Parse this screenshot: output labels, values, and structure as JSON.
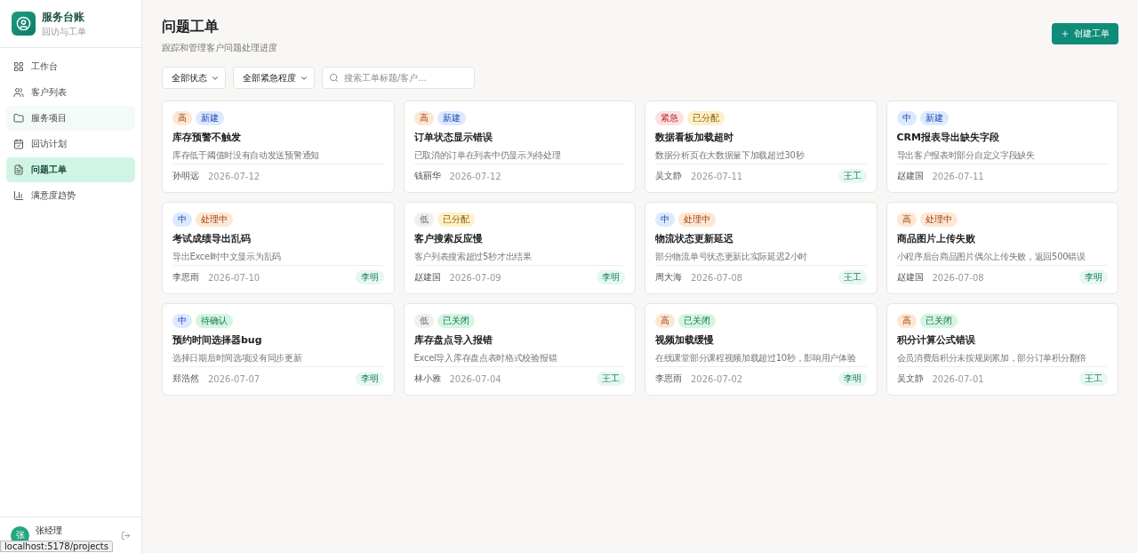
{
  "brand": {
    "title": "服务台账",
    "subtitle": "回访与工单"
  },
  "nav": [
    {
      "label": "工作台",
      "selected": false,
      "hovered": false
    },
    {
      "label": "客户列表",
      "selected": false,
      "hovered": false
    },
    {
      "label": "服务项目",
      "selected": false,
      "hovered": true
    },
    {
      "label": "回访计划",
      "selected": false,
      "hovered": false
    },
    {
      "label": "问题工单",
      "selected": true,
      "hovered": false
    },
    {
      "label": "满意度趋势",
      "selected": false,
      "hovered": false
    }
  ],
  "user": {
    "avatar": "张",
    "name": "张经理"
  },
  "status_tooltip": "localhost:5178/projects",
  "page": {
    "title": "问题工单",
    "subtitle": "跟踪和管理客户问题处理进度",
    "create_button": "创建工单"
  },
  "filters": {
    "status": "全部状态",
    "priority": "全部紧急程度",
    "search_placeholder": "搜索工单标题/客户..."
  },
  "tickets": [
    {
      "priority": {
        "label": "高",
        "kind": "high"
      },
      "status": {
        "label": "新建",
        "kind": "new"
      },
      "title": "库存预警不触发",
      "description": "库存低于阈值时没有自动发送预警通知",
      "customer": "孙明远",
      "date": "2026-07-12"
    },
    {
      "priority": {
        "label": "高",
        "kind": "high"
      },
      "status": {
        "label": "新建",
        "kind": "new"
      },
      "title": "订单状态显示错误",
      "description": "已取消的订单在列表中仍显示为待处理",
      "customer": "钱丽华",
      "date": "2026-07-12"
    },
    {
      "priority": {
        "label": "紧急",
        "kind": "urgent"
      },
      "status": {
        "label": "已分配",
        "kind": "assigned"
      },
      "title": "数据看板加载超时",
      "description": "数据分析页在大数据量下加载超过30秒",
      "customer": "吴文静",
      "date": "2026-07-11",
      "assignee": "王工"
    },
    {
      "priority": {
        "label": "中",
        "kind": "medium"
      },
      "status": {
        "label": "新建",
        "kind": "new"
      },
      "title": "CRM报表导出缺失字段",
      "description": "导出客户报表时部分自定义字段缺失",
      "customer": "赵建国",
      "date": "2026-07-11"
    },
    {
      "priority": {
        "label": "中",
        "kind": "medium"
      },
      "status": {
        "label": "处理中",
        "kind": "processing"
      },
      "title": "考试成绩导出乱码",
      "description": "导出Excel时中文显示为乱码",
      "customer": "李思雨",
      "date": "2026-07-10",
      "assignee": "李明"
    },
    {
      "priority": {
        "label": "低",
        "kind": "low"
      },
      "status": {
        "label": "已分配",
        "kind": "assigned"
      },
      "title": "客户搜索反应慢",
      "description": "客户列表搜索超过5秒才出结果",
      "customer": "赵建国",
      "date": "2026-07-09",
      "assignee": "李明"
    },
    {
      "priority": {
        "label": "中",
        "kind": "medium"
      },
      "status": {
        "label": "处理中",
        "kind": "processing"
      },
      "title": "物流状态更新延迟",
      "description": "部分物流单号状态更新比实际延迟2小时",
      "customer": "周大海",
      "date": "2026-07-08",
      "assignee": "王工"
    },
    {
      "priority": {
        "label": "高",
        "kind": "high"
      },
      "status": {
        "label": "处理中",
        "kind": "processing"
      },
      "title": "商品图片上传失败",
      "description": "小程序后台商品图片偶尔上传失败，返回500错误",
      "customer": "赵建国",
      "date": "2026-07-08",
      "assignee": "李明"
    },
    {
      "priority": {
        "label": "中",
        "kind": "medium"
      },
      "status": {
        "label": "待确认",
        "kind": "pending"
      },
      "title": "预约时间选择器bug",
      "description": "选择日期后时间选项没有同步更新",
      "customer": "郑浩然",
      "date": "2026-07-07",
      "assignee": "李明"
    },
    {
      "priority": {
        "label": "低",
        "kind": "low"
      },
      "status": {
        "label": "已关闭",
        "kind": "closed"
      },
      "title": "库存盘点导入报错",
      "description": "Excel导入库存盘点表时格式校验报错",
      "customer": "林小雅",
      "date": "2026-07-04",
      "assignee": "王工"
    },
    {
      "priority": {
        "label": "高",
        "kind": "high"
      },
      "status": {
        "label": "已关闭",
        "kind": "closed"
      },
      "title": "视频加载缓慢",
      "description": "在线课堂部分课程视频加载超过10秒，影响用户体验",
      "customer": "李思雨",
      "date": "2026-07-02",
      "assignee": "李明"
    },
    {
      "priority": {
        "label": "高",
        "kind": "high"
      },
      "status": {
        "label": "已关闭",
        "kind": "closed"
      },
      "title": "积分计算公式错误",
      "description": "会员消费后积分未按规则累加，部分订单积分翻倍",
      "customer": "吴文静",
      "date": "2026-07-01",
      "assignee": "王工"
    }
  ]
}
